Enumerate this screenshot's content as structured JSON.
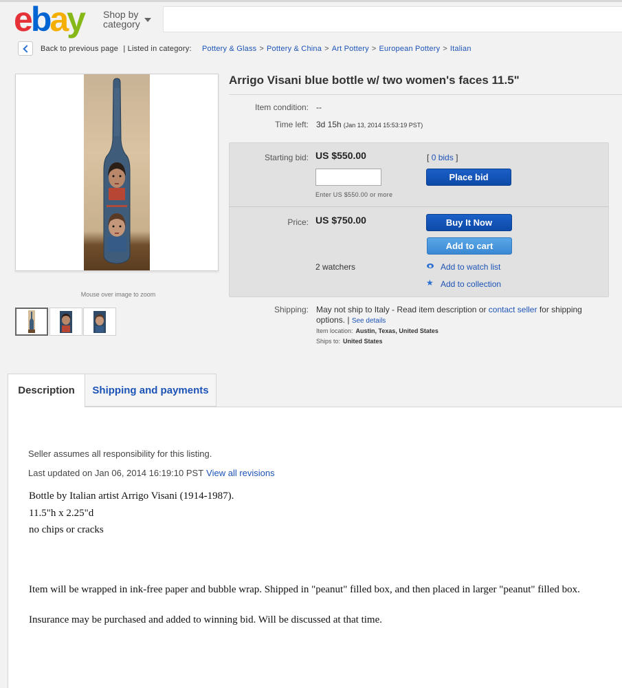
{
  "header": {
    "logo_letters": [
      "e",
      "b",
      "a",
      "y"
    ],
    "logo_colors": [
      "#e53238",
      "#0064d2",
      "#f5af02",
      "#86b817"
    ],
    "shop_by_line1": "Shop by",
    "shop_by_line2": "category"
  },
  "breadcrumb": {
    "back_label": "Back to previous page",
    "listed_label": "| Listed in category:",
    "items": [
      "Pottery & Glass",
      "Pottery & China",
      "Art Pottery",
      "European Pottery",
      "Italian"
    ]
  },
  "gallery": {
    "zoom_hint": "Mouse over image to zoom"
  },
  "listing": {
    "title": "Arrigo Visani blue bottle w/ two women's faces 11.5\"",
    "condition_label": "Item condition:",
    "condition_value": "--",
    "time_left_label": "Time left:",
    "time_left_value": "3d 15h",
    "time_left_end": "(Jan 13, 2014  15:53:19 PST)"
  },
  "bidding": {
    "starting_bid_label": "Starting bid:",
    "starting_bid_value": "US $550.00",
    "bids_open": "[",
    "bids_link": "0 bids",
    "bids_close": "]",
    "bid_input_value": "",
    "bid_hint": "Enter US $550.00 or more",
    "place_bid_label": "Place bid",
    "price_label": "Price:",
    "price_value": "US $750.00",
    "buy_now_label": "Buy It Now",
    "add_to_cart_label": "Add to cart",
    "watchers": "2 watchers",
    "watch_list_label": "Add to watch list",
    "collection_label": "Add to collection"
  },
  "shipping": {
    "label": "Shipping:",
    "text_1": "May not ship to Italy - Read item description or ",
    "contact_link": "contact seller",
    "text_2": " for shipping options. | ",
    "see_details": "See details",
    "location_label": "Item location:",
    "location_value": "Austin, Texas, United States",
    "ships_to_label": "Ships to:",
    "ships_to_value": "United States"
  },
  "tabs": {
    "description": "Description",
    "shipping_payments": "Shipping and payments"
  },
  "description": {
    "seller_responsibility": "Seller assumes all responsibility for this listing.",
    "last_updated": "Last updated on  Jan 06, 2014 16:19:10 PST",
    "view_revisions": "View all revisions",
    "line1": "Bottle by Italian artist Arrigo Visani (1914-1987).",
    "line2": "11.5\"h x 2.25\"d",
    "line3": "no chips or cracks",
    "line4": "Item will be wrapped in ink-free paper and bubble wrap.  Shipped in \"peanut\" filled box, and then placed in larger \"peanut\" filled box.",
    "line5": "Insurance may be purchased and added to winning bid.  Will be discussed at that time."
  }
}
